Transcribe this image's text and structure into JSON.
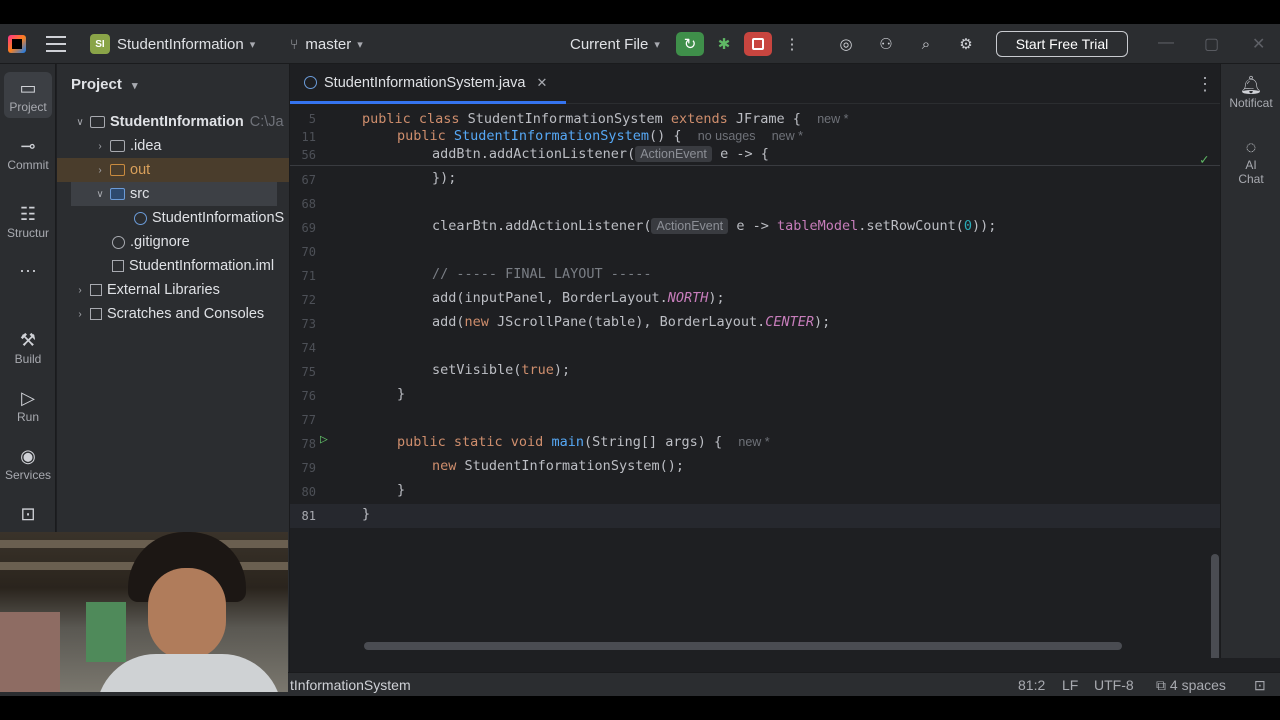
{
  "titlebar": {
    "project_badge": "SI",
    "project_name": "StudentInformation",
    "branch": "master",
    "run_config": "Current File",
    "trial_button": "Start Free Trial"
  },
  "left_tools": [
    {
      "label": "Project",
      "icon": "folder-icon"
    },
    {
      "label": "Commit",
      "icon": "commit-icon"
    },
    {
      "label": "Structur",
      "icon": "structure-icon"
    },
    {
      "label": "Build",
      "icon": "hammer-icon"
    },
    {
      "label": "Run",
      "icon": "run-icon"
    },
    {
      "label": "Services",
      "icon": "services-icon"
    }
  ],
  "project_panel": {
    "title": "Project",
    "tree": [
      {
        "label": "StudentInformation",
        "suffix": "C:\\Ja"
      },
      {
        "label": ".idea"
      },
      {
        "label": "out"
      },
      {
        "label": "src"
      },
      {
        "label": "StudentInformationS"
      },
      {
        "label": ".gitignore"
      },
      {
        "label": "StudentInformation.iml"
      },
      {
        "label": "External Libraries"
      },
      {
        "label": "Scratches and Consoles"
      }
    ]
  },
  "editor": {
    "tab": "StudentInformationSystem.java",
    "line_numbers": [
      "5",
      "11",
      "56",
      "67",
      "68",
      "69",
      "70",
      "71",
      "72",
      "73",
      "74",
      "75",
      "76",
      "77",
      "78",
      "79",
      "80",
      "81"
    ],
    "hints": {
      "new": "new *",
      "no_usages": "no usages",
      "action_event": "ActionEvent"
    },
    "code": {
      "l5_a": "public class ",
      "l5_b": "StudentInformationSystem ",
      "l5_c": "extends ",
      "l5_d": "JFrame {",
      "l11_a": "public ",
      "l11_b": "StudentInformationSystem",
      "l11_c": "() {",
      "l56_a": "addBtn.addActionListener(",
      "l56_b": "e -> {",
      "l67": "});",
      "l69_a": "clearBtn.addActionListener(",
      "l69_b": "e -> ",
      "l69_c": "tableModel",
      "l69_d": ".setRowCount(",
      "l69_e": "0",
      "l69_f": "));",
      "l71": "// ----- FINAL LAYOUT -----",
      "l72_a": "add(inputPanel, BorderLayout.",
      "l72_b": "NORTH",
      "l72_c": ");",
      "l73_a": "add(",
      "l73_b": "new ",
      "l73_c": "JScrollPane(table), BorderLayout.",
      "l73_d": "CENTER",
      "l73_e": ");",
      "l75_a": "setVisible(",
      "l75_b": "true",
      "l75_c": ");",
      "l76": "}",
      "l78_a": "public static void ",
      "l78_b": "main",
      "l78_c": "(String[] args) {",
      "l79_a": "new ",
      "l79_b": "StudentInformationSystem();",
      "l80": "}",
      "l81": "}"
    }
  },
  "right_tools": [
    {
      "label": "Notificat",
      "icon": "bell-icon"
    },
    {
      "label": "AI",
      "label2": "Chat",
      "icon": "ai-chat-icon"
    }
  ],
  "statusbar": {
    "breadcrumb": "tInformationSystem",
    "position": "81:2",
    "line_sep": "LF",
    "encoding": "UTF-8",
    "indent": "4 spaces"
  },
  "colors": {
    "accent": "#3574f0",
    "run": "#3f8f4a",
    "stop": "#c8453f",
    "keyword": "#cf8e6d",
    "function": "#56a8f5"
  }
}
